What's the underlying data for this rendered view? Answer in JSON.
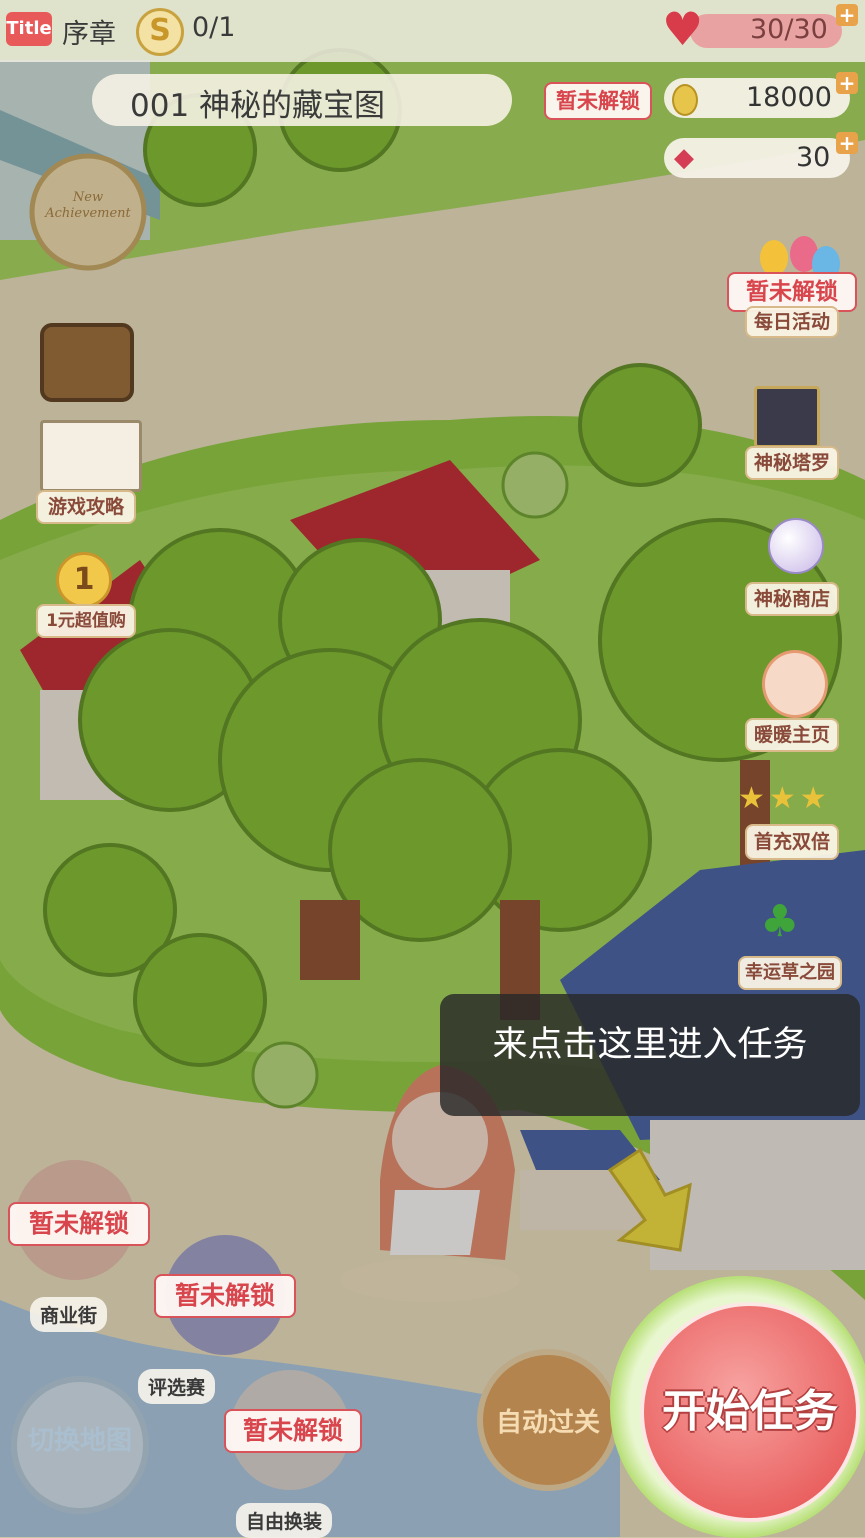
{
  "header": {
    "title_tag": "Title",
    "chapter": "序章",
    "coin_symbol": "S",
    "progress": "0/1",
    "hp": "30/30"
  },
  "level": {
    "title": "001 神秘的藏宝图",
    "locked_label": "暂未解锁"
  },
  "resources": {
    "gold": "18000",
    "gems": "30"
  },
  "badge": {
    "text": "New Achievement"
  },
  "left_menu": {
    "guide": "游戏攻略",
    "one_yuan_num": "1",
    "one_yuan": "1元超值购"
  },
  "right_menu": {
    "daily_locked": "暂未解锁",
    "daily": "每日活动",
    "tarot": "神秘塔罗",
    "shop": "神秘商店",
    "homepage": "暖暖主页",
    "first_charge": "首充双倍",
    "clover": "幸运草之园"
  },
  "tooltip": {
    "text": "来点击这里进入任务"
  },
  "bottom": {
    "commerce_locked": "暂未解锁",
    "commerce": "商业街",
    "contest_locked": "暂未解锁",
    "contest": "评选赛",
    "free_locked": "暂未解锁",
    "free_dress": "自由换装",
    "switch_map": "切换地图",
    "auto_pass": "自动过关",
    "start_task": "开始任务"
  },
  "colors": {
    "accent_red": "#e9605f",
    "locked_red": "#d8454c",
    "grass": "#9bd34f",
    "ground": "#ede3c3"
  }
}
